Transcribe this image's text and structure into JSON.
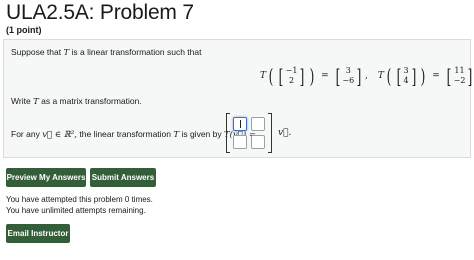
{
  "header": {
    "title": "ULA2.5A: Problem 7",
    "points": "(1 point)"
  },
  "problem": {
    "intro_prefix": "Suppose that",
    "intro_var": "T",
    "intro_suffix": "is a linear transformation such that",
    "eq": {
      "T": "T",
      "v1": [
        "−1",
        "2"
      ],
      "r1": [
        "3",
        "−6"
      ],
      "v2": [
        "3",
        "4"
      ],
      "r2": [
        "11",
        "−2"
      ],
      "sep": ",",
      "end": ","
    },
    "write_prefix": "Write",
    "write_var": "T",
    "write_suffix": "as a matrix transformation.",
    "for_any_text": "For any",
    "vec_in": "v⃗ ∈ ℝ²,",
    "given_by_text": "the linear transformation",
    "given_var": "T",
    "given_by_text2": "is given by",
    "t_of_v": "T(v⃗) =",
    "after_matrix": "v⃗."
  },
  "buttons": {
    "preview": "Preview My Answers",
    "submit": "Submit Answers",
    "email": "Email Instructor"
  },
  "status": {
    "attempts": "You have attempted this problem 0 times.",
    "remaining": "You have unlimited attempts remaining."
  }
}
